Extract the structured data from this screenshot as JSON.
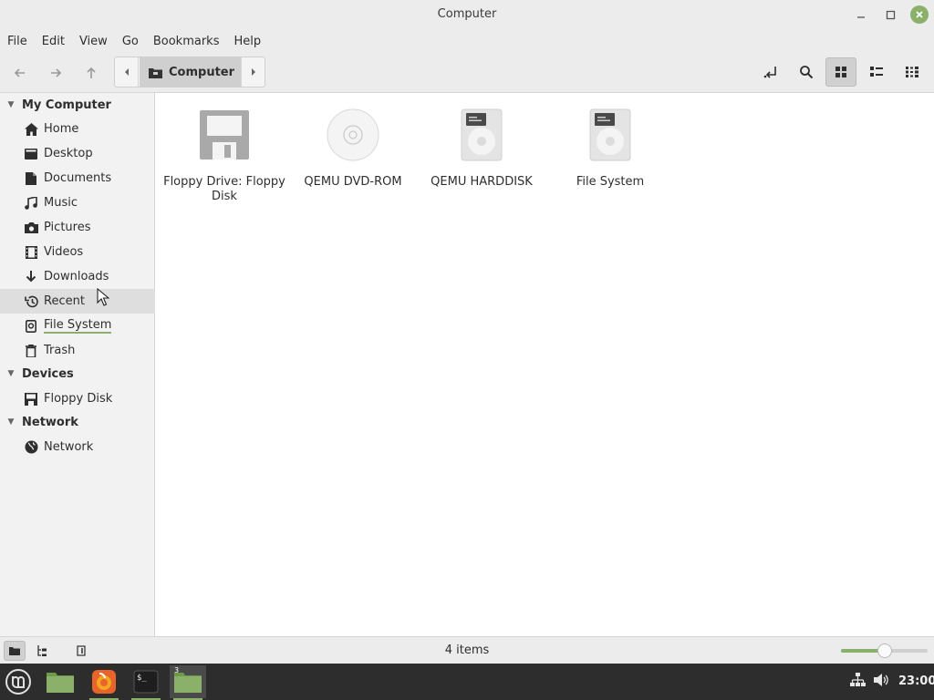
{
  "window": {
    "title": "Computer"
  },
  "menubar": {
    "items": [
      "File",
      "Edit",
      "View",
      "Go",
      "Bookmarks",
      "Help"
    ]
  },
  "pathbar": {
    "current": "Computer"
  },
  "sidebar": {
    "sections": [
      {
        "label": "My Computer"
      },
      {
        "label": "Devices"
      },
      {
        "label": "Network"
      }
    ],
    "my_computer": [
      {
        "label": "Home",
        "icon": "home-icon"
      },
      {
        "label": "Desktop",
        "icon": "desktop-icon"
      },
      {
        "label": "Documents",
        "icon": "documents-icon"
      },
      {
        "label": "Music",
        "icon": "music-icon"
      },
      {
        "label": "Pictures",
        "icon": "camera-icon"
      },
      {
        "label": "Videos",
        "icon": "film-icon"
      },
      {
        "label": "Downloads",
        "icon": "download-icon"
      },
      {
        "label": "Recent",
        "icon": "history-icon"
      },
      {
        "label": "File System",
        "icon": "drive-icon"
      },
      {
        "label": "Trash",
        "icon": "trash-icon"
      }
    ],
    "devices": [
      {
        "label": "Floppy Disk",
        "icon": "floppy-icon"
      }
    ],
    "network": [
      {
        "label": "Network",
        "icon": "globe-icon"
      }
    ]
  },
  "files": [
    {
      "label": "Floppy Drive: Floppy Disk",
      "icon": "floppy-drive-icon"
    },
    {
      "label": "QEMU DVD-ROM",
      "icon": "optical-disc-icon"
    },
    {
      "label": "QEMU HARDDISK",
      "icon": "hard-disk-icon"
    },
    {
      "label": "File System",
      "icon": "hard-disk-icon"
    }
  ],
  "statusbar": {
    "text": "4 items",
    "zoom_level": 0.5
  },
  "taskbar": {
    "clock": "23:00",
    "terminal_badge": "3"
  },
  "colors": {
    "accent": "#8ab06a",
    "panel": "#2d2d2d",
    "sidebar": "#f2f2f2"
  }
}
